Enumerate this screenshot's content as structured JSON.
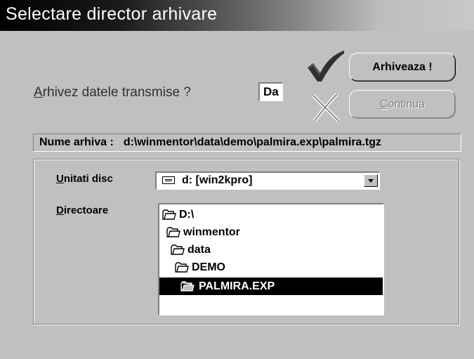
{
  "window": {
    "title": "Selectare director arhivare"
  },
  "question": {
    "underlined": "A",
    "rest": "rhivez datele transmise ?",
    "answer": "Da"
  },
  "buttons": {
    "archive_label": "Arhiveaza !",
    "continue_underlined": "C",
    "continue_rest": "ontinua"
  },
  "archive": {
    "label": "Nume arhiva :",
    "path": "d:\\winmentor\\data\\demo\\palmira.exp\\palmira.tgz"
  },
  "drives": {
    "label_underlined": "U",
    "label_rest": "nitati disc",
    "selected": "d: [win2kpro]"
  },
  "directories": {
    "label_underlined": "D",
    "label_rest": "irectoare",
    "items": [
      {
        "name": "D:\\"
      },
      {
        "name": "winmentor"
      },
      {
        "name": "data"
      },
      {
        "name": "DEMO"
      },
      {
        "name": "PALMIRA.EXP",
        "selected": true
      }
    ]
  },
  "icons": {
    "confirm": "check-icon",
    "cancel": "x-icon",
    "drive": "drive-icon",
    "folder": "folder-icon"
  }
}
